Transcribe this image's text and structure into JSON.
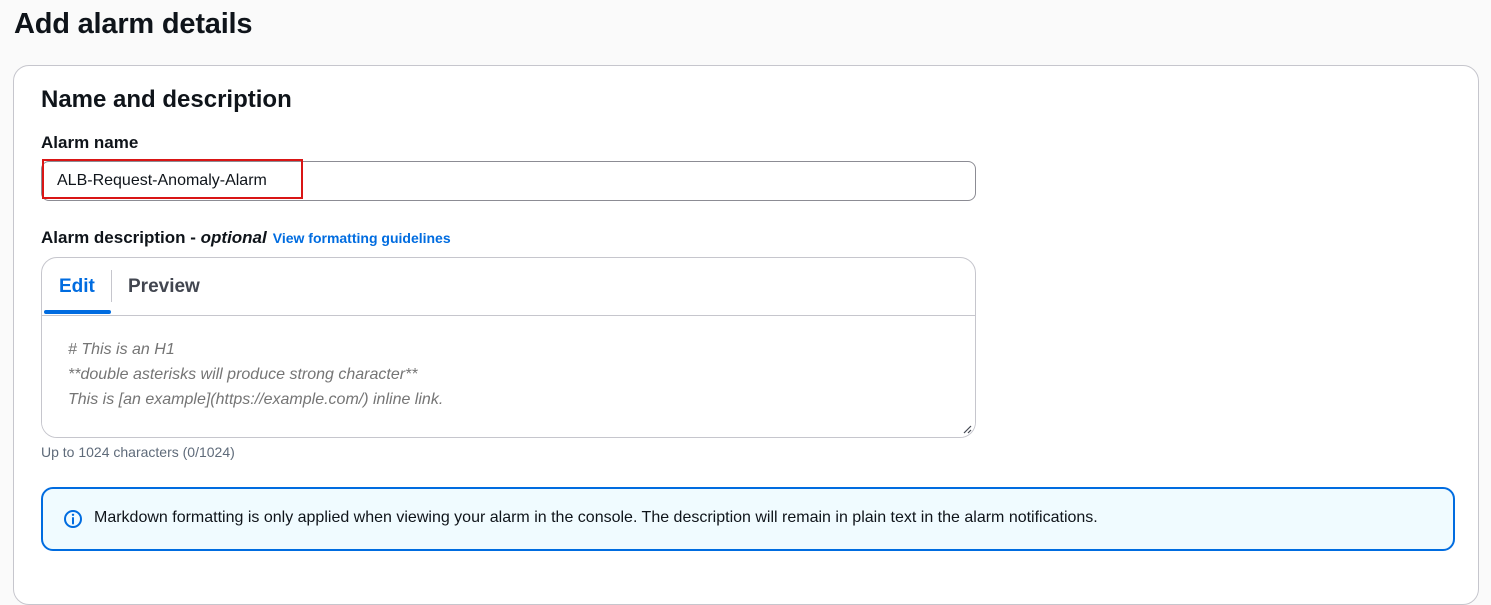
{
  "page": {
    "title": "Add alarm details"
  },
  "section": {
    "title": "Name and description"
  },
  "alarm_name": {
    "label": "Alarm name",
    "value": "ALB-Request-Anomaly-Alarm"
  },
  "alarm_description": {
    "label": "Alarm description - ",
    "optional": "optional",
    "link": "View formatting guidelines",
    "tabs": [
      {
        "label": "Edit",
        "active": true
      },
      {
        "label": "Preview",
        "active": false
      }
    ],
    "value": "",
    "placeholder": "# This is an H1\n**double asterisks will produce strong character**\nThis is [an example](https://example.com/) inline link.",
    "char_count": "Up to 1024 characters (0/1024)"
  },
  "info_alert": {
    "icon": "info-icon",
    "text": "Markdown formatting is only applied when viewing your alarm in the console. The description will remain in plain text in the alarm notifications."
  },
  "colors": {
    "accent": "#006ce0",
    "highlight": "#d91515",
    "alert_background": "#f0fbff"
  }
}
